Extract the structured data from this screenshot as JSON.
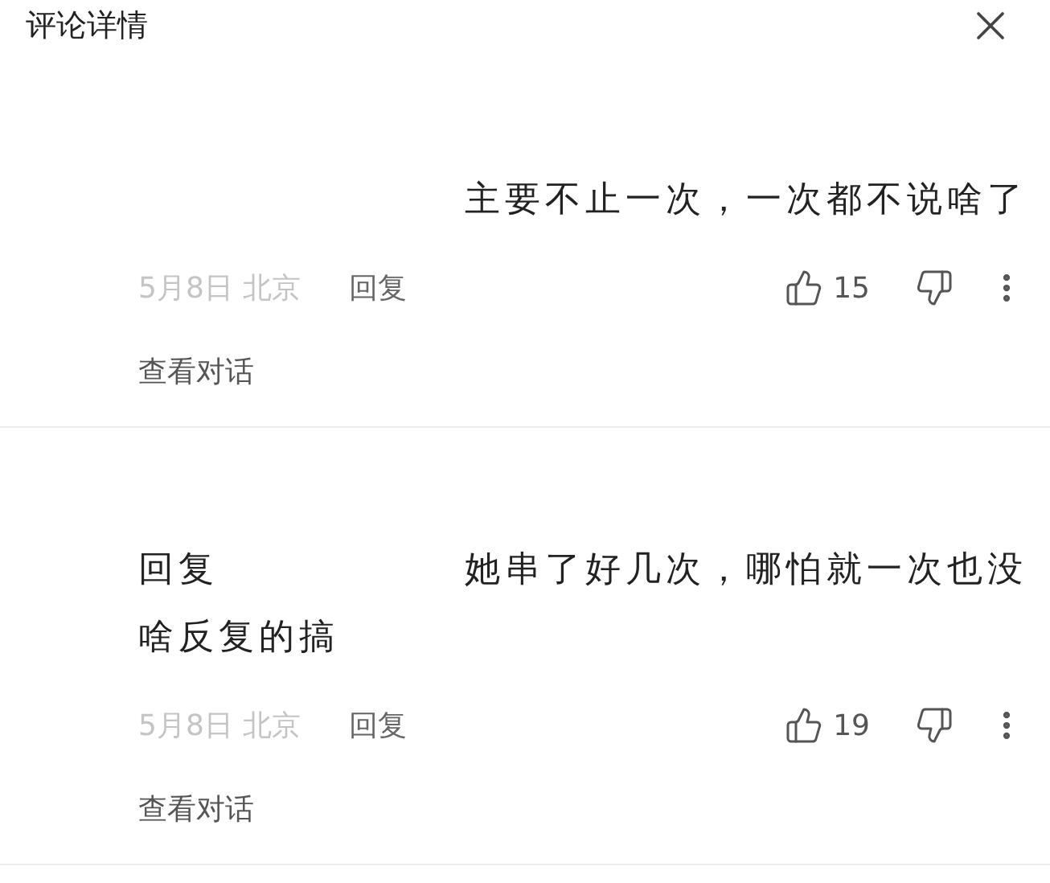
{
  "header": {
    "title": "评论详情"
  },
  "comments": [
    {
      "kind": "comment",
      "text_lines": [
        "主要不止一次，一次都不说啥了"
      ],
      "date": "5月8日",
      "location": "北京",
      "reply_label": "回复",
      "likes": "15",
      "view_conversation": "查看对话"
    },
    {
      "kind": "reply",
      "prefix": "回复",
      "text_lines": [
        "她串了好几次，哪怕就一次也没",
        "啥反复的搞"
      ],
      "date": "5月8日",
      "location": "北京",
      "reply_label": "回复",
      "likes": "19",
      "view_conversation": "查看对话"
    }
  ]
}
